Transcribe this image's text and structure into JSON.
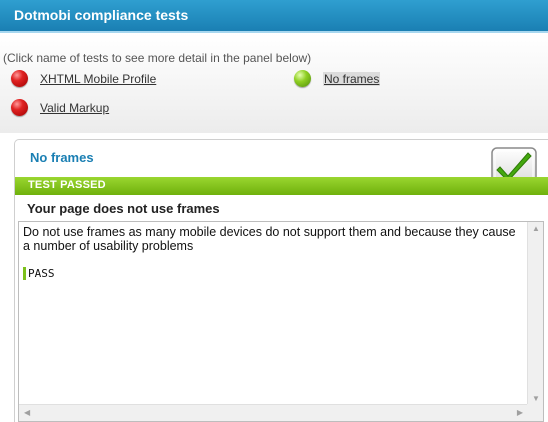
{
  "header": {
    "title": "Dotmobi compliance tests"
  },
  "hint": "(Click name of tests to see more detail in the panel below)",
  "tests": [
    {
      "name": "XHTML Mobile Profile",
      "status": "fail",
      "color": "#e02222"
    },
    {
      "name": "No frames",
      "status": "pass",
      "color": "#8fcf23"
    },
    {
      "name": "Valid Markup",
      "status": "fail",
      "color": "#e02222"
    }
  ],
  "panel": {
    "title": "No frames",
    "status_label": "TEST PASSED",
    "status_color": "#7dbd15",
    "badge_icon": "green-checkmark-icon",
    "result_heading": "Your page does not use frames",
    "description": "Do not use frames as many mobile devices do not support them and because they cause a number of usability problems",
    "result_code": "PASS"
  },
  "colors": {
    "header": "#1a8cc4",
    "accent_text": "#1a7fb3"
  }
}
